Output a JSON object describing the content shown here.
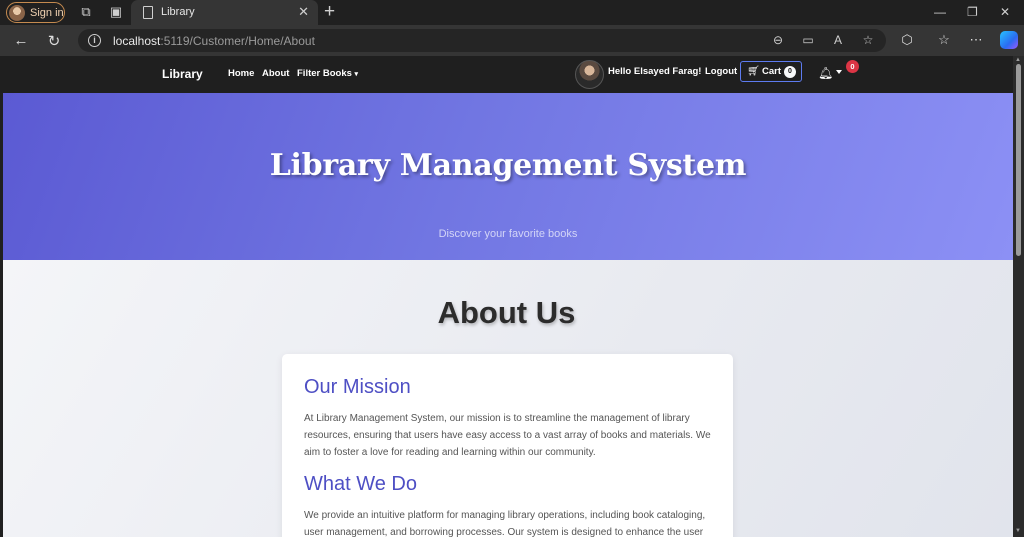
{
  "browser": {
    "signin_label": "Sign in",
    "tab_title": "Library",
    "url_host": "localhost",
    "url_path": ":5119/Customer/Home/About"
  },
  "site": {
    "brand": "Library",
    "nav": [
      "Home",
      "About",
      "Filter Books"
    ],
    "greeting": "Hello Elsayed Farag!",
    "logout": "Logout",
    "cart_label": "Cart",
    "cart_count": "0",
    "notification_count": "0"
  },
  "hero": {
    "title": "Library Management System",
    "subtitle": "Discover your favorite books"
  },
  "about": {
    "heading": "About Us",
    "mission_title": "Our Mission",
    "mission_text": "At Library Management System, our mission is to streamline the management of library resources, ensuring that users have easy access to a vast array of books and materials. We aim to foster a love for reading and learning within our community.",
    "whatwedo_title": "What We Do",
    "whatwedo_text": "We provide an intuitive platform for managing library operations, including book cataloging, user management, and borrowing processes. Our system is designed to enhance the user"
  },
  "colors": {
    "hero_start": "#5b5ad3",
    "hero_end": "#8c90f5",
    "card_heading": "#4e4fc4",
    "badge_red": "#dc3545"
  }
}
